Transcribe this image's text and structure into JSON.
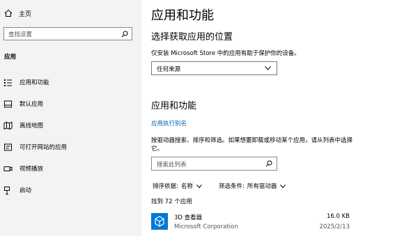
{
  "sidebar": {
    "home_label": "主页",
    "search_placeholder": "查找设置",
    "section_label": "应用",
    "items": [
      {
        "label": "应用和功能",
        "icon": "apps-list-icon"
      },
      {
        "label": "默认应用",
        "icon": "default-apps-icon"
      },
      {
        "label": "离线地图",
        "icon": "offline-maps-icon"
      },
      {
        "label": "可打开网站的应用",
        "icon": "website-apps-icon"
      },
      {
        "label": "视频播放",
        "icon": "video-playback-icon"
      },
      {
        "label": "启动",
        "icon": "startup-icon"
      }
    ]
  },
  "main": {
    "title": "应用和功能",
    "source_heading": "选择获取应用的位置",
    "source_desc": "仅安装 Microsoft Store 中的应用有助于保护你的设备。",
    "source_dropdown_value": "任何来源",
    "apps_heading": "应用和功能",
    "alias_link": "应用执行别名",
    "apps_desc": "按驱动器搜索、排序和筛选。如果想要卸载或移动某个应用，请从列表中选择它。",
    "apps_search_placeholder": "搜索此列表",
    "sort_label": "排序依据:",
    "sort_value": "名称",
    "filter_label": "筛选条件:",
    "filter_value": "所有驱动器",
    "found_count": "找到 72 个应用",
    "apps": [
      {
        "name": "3D 查看器",
        "publisher": "Microsoft Corporation",
        "size": "16.0 KB",
        "date": "2025/2/13"
      }
    ]
  },
  "colors": {
    "accent": "#0078d7",
    "link": "#0063b1",
    "sidebar_bg": "#f3f3f3"
  }
}
